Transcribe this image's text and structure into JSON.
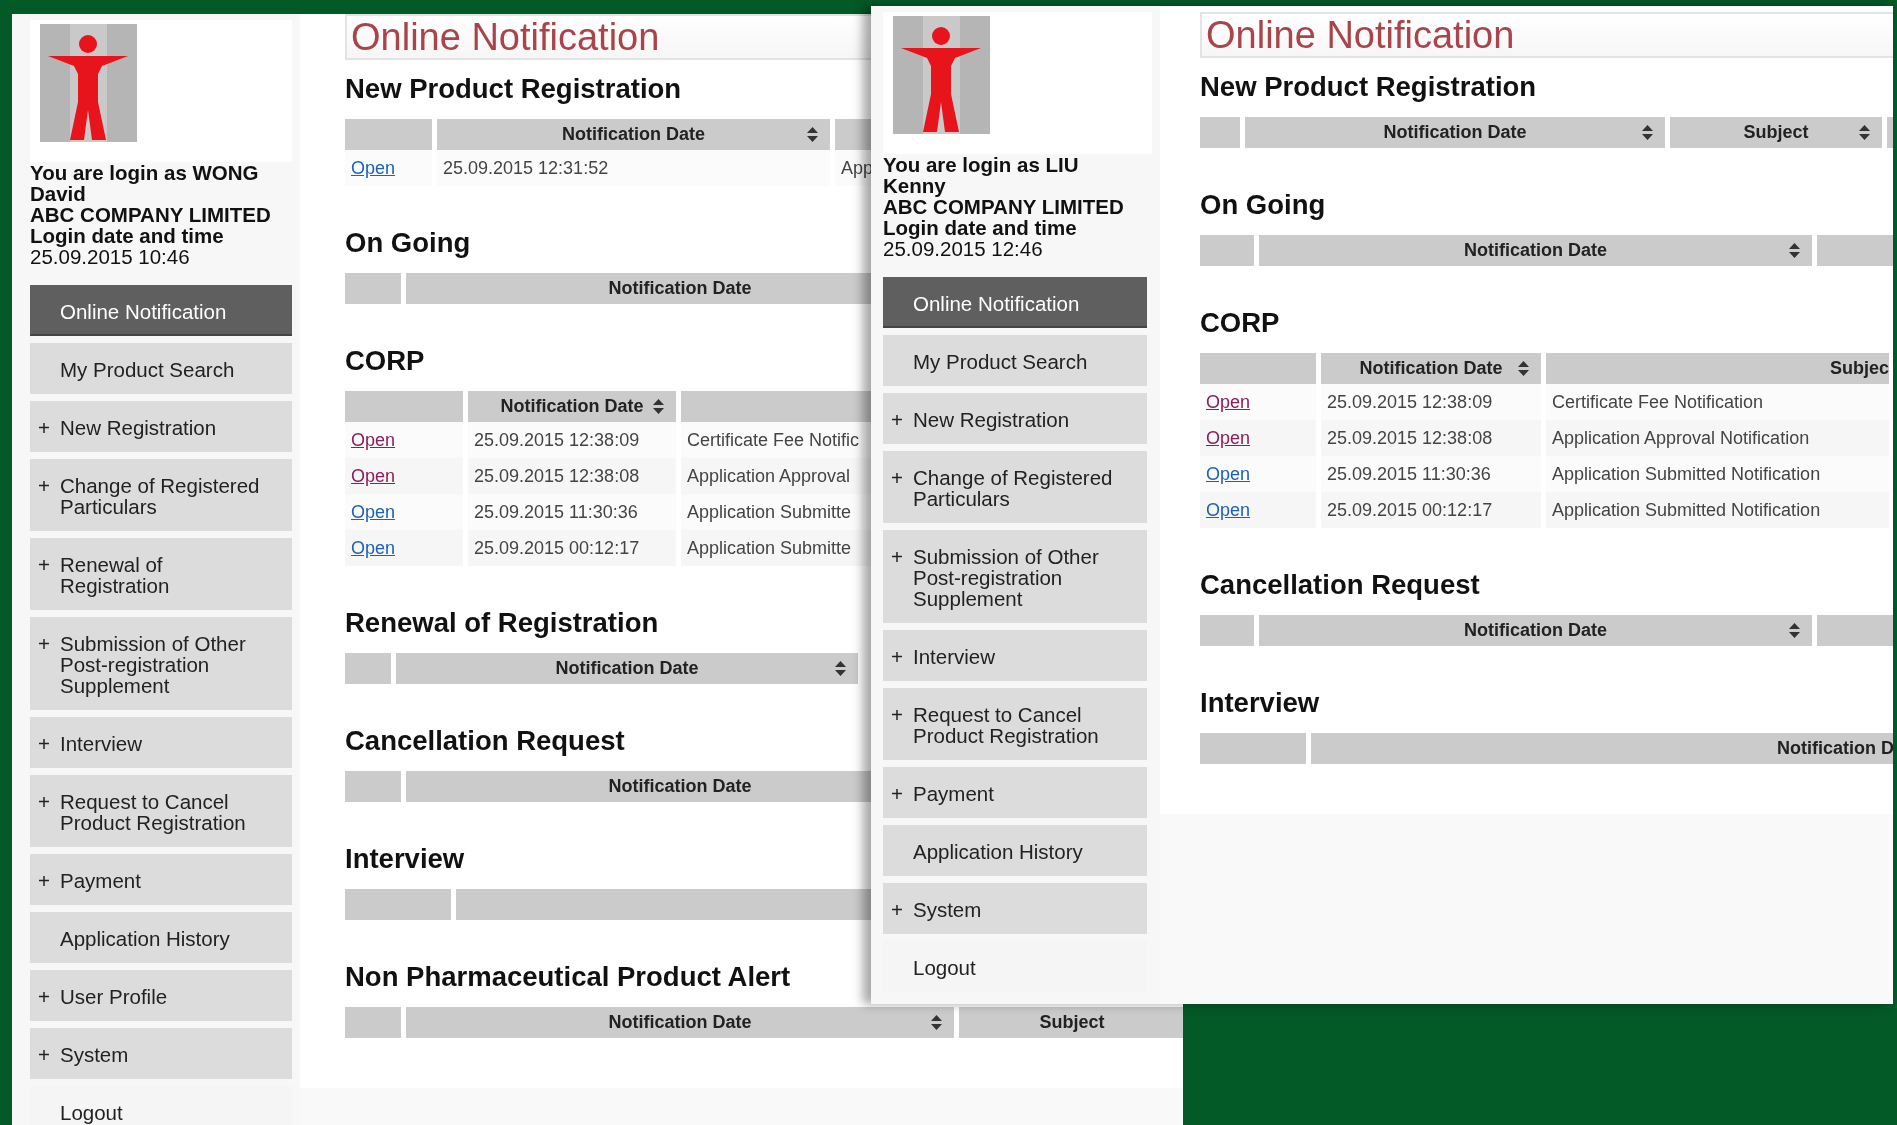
{
  "windows": [
    {
      "user_info": [
        {
          "text": "You are login as WONG David",
          "bold": true
        },
        {
          "text": "ABC COMPANY LIMITED",
          "bold": true
        },
        {
          "text": "Login date and time",
          "bold": true
        },
        {
          "text": "25.09.2015 10:46",
          "bold": false
        }
      ],
      "menu": [
        {
          "label": "Online Notification",
          "selected": true,
          "kind": "menu"
        },
        {
          "label": "My Product Search",
          "selected": false,
          "kind": "menu"
        },
        {
          "marker": "+",
          "label": "New Registration",
          "selected": false,
          "kind": "menu"
        },
        {
          "marker": "+",
          "label": "Change of Registered Particulars",
          "selected": false,
          "kind": "menu"
        },
        {
          "marker": "+",
          "label": "Renewal of Registration",
          "selected": false,
          "kind": "menu"
        },
        {
          "marker": "+",
          "label": "Submission of Other Post-registration Supplement",
          "selected": false,
          "kind": "menu"
        },
        {
          "marker": "+",
          "label": "Interview",
          "selected": false,
          "kind": "menu"
        },
        {
          "marker": "+",
          "label": "Request to Cancel Product Registration",
          "selected": false,
          "kind": "menu"
        },
        {
          "marker": "+",
          "label": "Payment",
          "selected": false,
          "kind": "menu"
        },
        {
          "label": "Application History",
          "selected": false,
          "kind": "menu"
        },
        {
          "marker": "+",
          "label": "User Profile",
          "selected": false,
          "kind": "menu"
        },
        {
          "marker": "+",
          "label": "System",
          "selected": false,
          "kind": "menu"
        },
        {
          "label": "Logout",
          "selected": false,
          "kind": "plain"
        }
      ],
      "title": "Online Notification",
      "sections": [
        {
          "heading": "New Product Registration",
          "columns": [
            {
              "sortable": false
            },
            {
              "label": "Notification Date",
              "sortable": true
            },
            {}
          ],
          "rows": [
            {
              "link": "Open",
              "visited": false,
              "date": "25.09.2015 12:31:52",
              "subject": "App"
            }
          ]
        },
        {
          "heading": "On Going",
          "columns": [
            {
              "sortable": false
            },
            {
              "label": "Notification Date"
            }
          ]
        },
        {
          "heading": "CORP",
          "columns": [
            {
              "sortable": false
            },
            {
              "label": "Notification Date",
              "sortable": true
            },
            {
              "sortable": false
            }
          ],
          "rows": [
            {
              "link": "Open",
              "visited": true,
              "date": "25.09.2015 12:38:09",
              "subject": "Certificate Fee Notific"
            },
            {
              "link": "Open",
              "visited": true,
              "date": "25.09.2015 12:38:08",
              "subject": "Application Approval"
            },
            {
              "link": "Open",
              "visited": false,
              "date": "25.09.2015 11:30:36",
              "subject": "Application Submitte"
            },
            {
              "link": "Open",
              "visited": false,
              "date": "25.09.2015 00:12:17",
              "subject": "Application Submitte"
            }
          ]
        },
        {
          "heading": "Renewal of Registration",
          "columns": [
            {
              "sortable": false
            },
            {
              "label": "Notification Date",
              "sortable": true
            }
          ]
        },
        {
          "heading": "Cancellation Request",
          "columns": [
            {
              "sortable": false
            },
            {
              "label": "Notification Date"
            }
          ]
        },
        {
          "heading": "Interview",
          "columns": [
            {
              "sortable": false
            },
            {
              "sortable": false
            }
          ]
        },
        {
          "heading": "Non Pharmaceutical Product Alert",
          "columns": [
            {
              "sortable": false
            },
            {
              "label": "Notification Date",
              "sortable": true
            },
            {
              "label": "Subject",
              "sortable": false
            }
          ]
        }
      ]
    },
    {
      "user_info": [
        {
          "text": "You are login as LIU Kenny",
          "bold": true
        },
        {
          "text": "ABC COMPANY LIMITED",
          "bold": true
        },
        {
          "text": "Login date and time",
          "bold": true
        },
        {
          "text": "25.09.2015 12:46",
          "bold": false
        }
      ],
      "menu": [
        {
          "label": "Online Notification",
          "selected": true,
          "kind": "menu"
        },
        {
          "label": "My Product Search",
          "selected": false,
          "kind": "menu"
        },
        {
          "marker": "+",
          "label": "New Registration",
          "selected": false,
          "kind": "menu"
        },
        {
          "marker": "+",
          "label": "Change of Registered Particulars",
          "selected": false,
          "kind": "menu"
        },
        {
          "marker": "+",
          "label": "Submission of Other Post-registration Supplement",
          "selected": false,
          "kind": "menu"
        },
        {
          "marker": "+",
          "label": "Interview",
          "selected": false,
          "kind": "menu"
        },
        {
          "marker": "+",
          "label": "Request to Cancel Product Registration",
          "selected": false,
          "kind": "menu"
        },
        {
          "marker": "+",
          "label": "Payment",
          "selected": false,
          "kind": "menu"
        },
        {
          "label": "Application History",
          "selected": false,
          "kind": "menu"
        },
        {
          "marker": "+",
          "label": "System",
          "selected": false,
          "kind": "menu"
        },
        {
          "label": "Logout",
          "selected": false,
          "kind": "plain"
        }
      ],
      "title": "Online Notification",
      "sections": [
        {
          "heading": "New Product Registration",
          "columns": [
            {
              "sortable": false
            },
            {
              "label": "Notification Date",
              "sortable": true
            },
            {
              "label": "Subject",
              "sortable": true
            },
            {}
          ]
        },
        {
          "heading": "On Going",
          "columns": [
            {
              "sortable": false
            },
            {
              "label": "Notification Date",
              "sortable": true
            },
            {}
          ]
        },
        {
          "heading": "CORP",
          "columns": [
            {
              "sortable": false
            },
            {
              "label": "Notification Date",
              "sortable": true
            },
            {
              "label": "Subjec",
              "sortable": false
            }
          ],
          "rows": [
            {
              "link": "Open",
              "visited": true,
              "date": "25.09.2015 12:38:09",
              "subject": "Certificate Fee Notification"
            },
            {
              "link": "Open",
              "visited": true,
              "date": "25.09.2015 12:38:08",
              "subject": "Application Approval Notification"
            },
            {
              "link": "Open",
              "visited": false,
              "date": "25.09.2015 11:30:36",
              "subject": "Application Submitted Notification"
            },
            {
              "link": "Open",
              "visited": false,
              "date": "25.09.2015 00:12:17",
              "subject": "Application Submitted Notification"
            }
          ]
        },
        {
          "heading": "Cancellation Request",
          "columns": [
            {
              "sortable": false
            },
            {
              "label": "Notification Date",
              "sortable": true
            },
            {}
          ]
        },
        {
          "heading": "Interview",
          "columns": [
            {
              "sortable": false
            },
            {
              "label": "Notification D",
              "sortable": false
            }
          ]
        }
      ]
    }
  ]
}
